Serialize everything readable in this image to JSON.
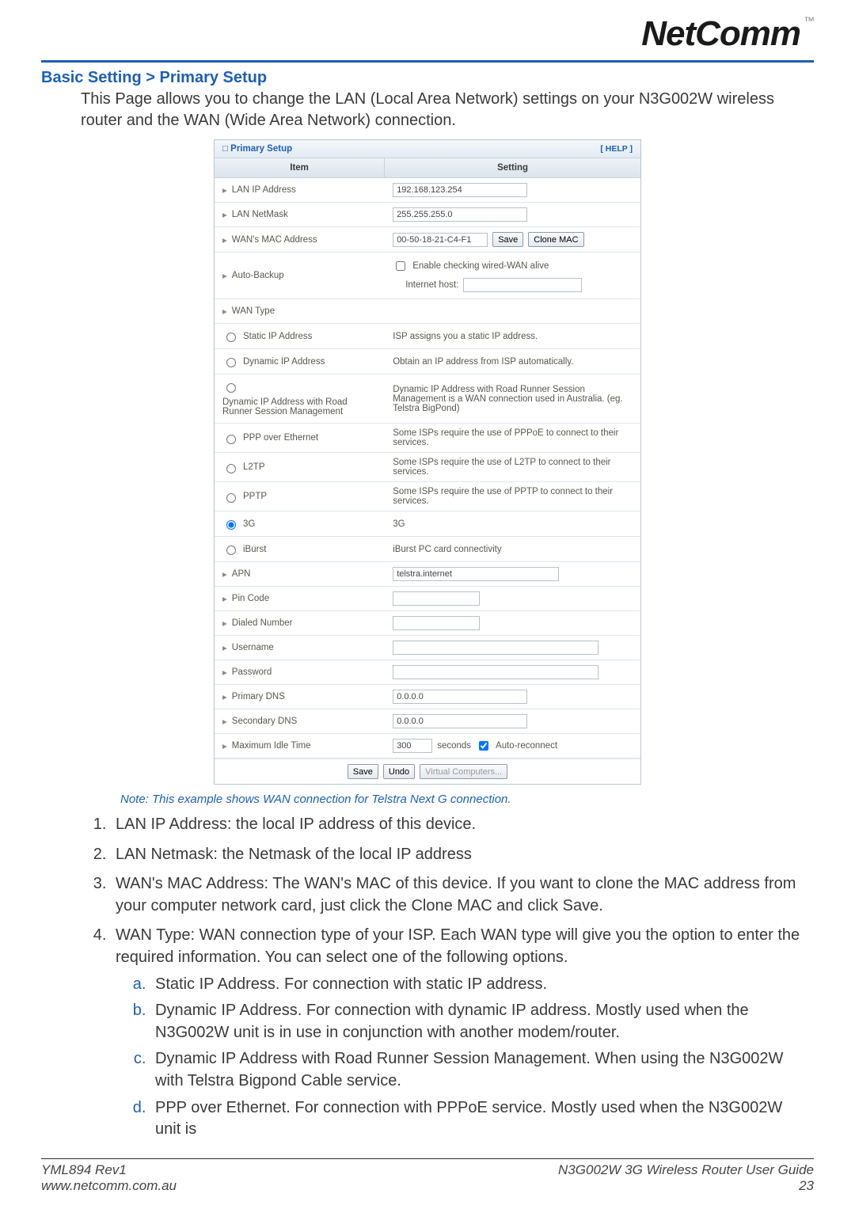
{
  "brand": {
    "name": "NetComm",
    "tm": "™"
  },
  "section_title": "Basic Setting > Primary Setup",
  "lead": "This Page allows you to change the LAN (Local Area Network) settings on your N3G002W wireless router and the WAN (Wide Area Network) connection.",
  "panel": {
    "title": "Primary Setup",
    "help": "[ HELP ]",
    "head_item": "Item",
    "head_setting": "Setting",
    "rows": {
      "lan_ip": {
        "label": "LAN IP Address",
        "value": "192.168.123.254"
      },
      "lan_mask": {
        "label": "LAN NetMask",
        "value": "255.255.255.0"
      },
      "wan_mac": {
        "label": "WAN's MAC Address",
        "value": "00-50-18-21-C4-F1",
        "btn_save": "Save",
        "btn_clone": "Clone MAC"
      },
      "autobackup": {
        "label": "Auto-Backup",
        "chk_label": "Enable checking wired-WAN alive",
        "host_label": "Internet host:",
        "host_value": ""
      },
      "wan_type": {
        "label": "WAN Type"
      },
      "apn": {
        "label": "APN",
        "value": "telstra.internet"
      },
      "pin": {
        "label": "Pin Code",
        "value": ""
      },
      "dialed": {
        "label": "Dialed Number",
        "value": ""
      },
      "user": {
        "label": "Username",
        "value": ""
      },
      "pass": {
        "label": "Password",
        "value": ""
      },
      "pdns": {
        "label": "Primary DNS",
        "value": "0.0.0.0"
      },
      "sdns": {
        "label": "Secondary DNS",
        "value": "0.0.0.0"
      },
      "idle": {
        "label": "Maximum Idle Time",
        "value": "300",
        "unit": "seconds",
        "auto_label": "Auto-reconnect"
      }
    },
    "wan_options": [
      {
        "label": "Static IP Address",
        "desc": "ISP assigns you a static IP address.",
        "selected": false
      },
      {
        "label": "Dynamic IP Address",
        "desc": "Obtain an IP address from ISP automatically.",
        "selected": false
      },
      {
        "label": "Dynamic IP Address with Road Runner Session Management",
        "desc": "Dynamic IP Address with Road Runner Session Management is a WAN connection used in Australia. (eg. Telstra BigPond)",
        "selected": false
      },
      {
        "label": "PPP over Ethernet",
        "desc": "Some ISPs require the use of PPPoE to connect to their services.",
        "selected": false
      },
      {
        "label": "L2TP",
        "desc": "Some ISPs require the use of L2TP to connect to their services.",
        "selected": false
      },
      {
        "label": "PPTP",
        "desc": "Some ISPs require the use of PPTP to connect to their services.",
        "selected": false
      },
      {
        "label": "3G",
        "desc": "3G",
        "selected": true
      },
      {
        "label": "iBurst",
        "desc": "iBurst PC card connectivity",
        "selected": false
      }
    ],
    "bottom": {
      "save": "Save",
      "undo": "Undo",
      "vc": "Virtual Computers..."
    }
  },
  "note": "Note: This example shows WAN connection for Telstra Next G connection.",
  "list": {
    "i1": "LAN IP Address: the local IP address of this device.",
    "i2": "LAN Netmask: the Netmask of the local IP address",
    "i3": "WAN's MAC Address: The WAN's MAC of this device. If you want to clone the MAC address from your computer network card, just click the Clone MAC and click Save.",
    "i4": "WAN Type: WAN connection type of your ISP. Each WAN type will give you the option to enter the required information. You can select one of the following options.",
    "i4a": "Static IP Address. For connection with static IP address.",
    "i4b": "Dynamic IP Address. For connection with dynamic IP address. Mostly used when the N3G002W unit is in use in conjunction with another modem/router.",
    "i4c": "Dynamic IP Address with Road Runner Session Management. When using the N3G002W with Telstra Bigpond Cable service.",
    "i4d": "PPP over Ethernet. For connection with PPPoE service. Mostly used when the N3G002W unit is"
  },
  "footer": {
    "left1": "YML894 Rev1",
    "left2": "www.netcomm.com.au",
    "right1": "N3G002W 3G Wireless Router User Guide",
    "right2": "23"
  }
}
